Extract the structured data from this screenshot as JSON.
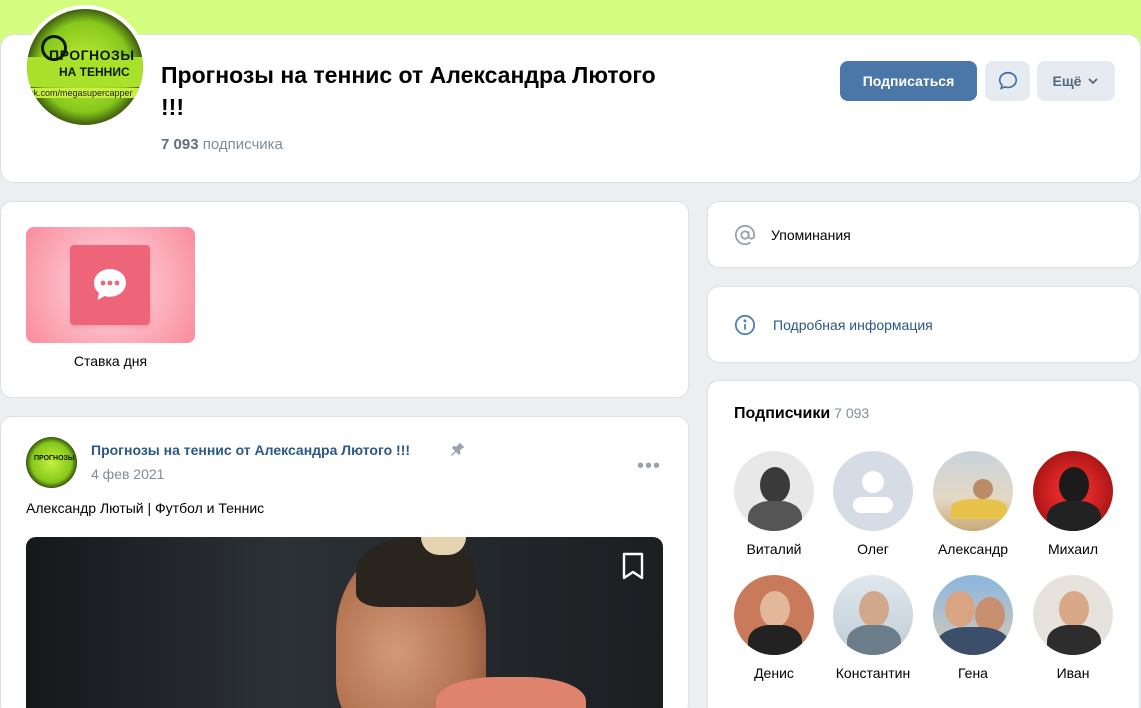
{
  "header": {
    "avatar_text_line1": "ПРОГНОЗЫ",
    "avatar_text_line2": "НА ТЕННИС",
    "avatar_url_text": "vk.com/megasupercapper",
    "title": "Прогнозы на теннис от Александра Лютого !!!",
    "subscribers_number": "7 093",
    "subscribers_word": "подписчика",
    "subscribe_button": "Подписаться",
    "more_button": "Ещё"
  },
  "widget": {
    "label": "Ставка дня"
  },
  "post": {
    "author": "Прогнозы на теннис от Александра Лютого !!!",
    "date": "4 фев 2021",
    "text": "Александр Лютый | Футбол и Теннис",
    "menu": "•••"
  },
  "sidebar": {
    "mentions_label": "Упоминания",
    "info_label": "Подробная информация",
    "followers_title": "Подписчики",
    "followers_count": "7 093",
    "followers": [
      {
        "name": "Виталий"
      },
      {
        "name": "Олег"
      },
      {
        "name": "Александр"
      },
      {
        "name": "Михаил"
      },
      {
        "name": "Денис"
      },
      {
        "name": "Константин"
      },
      {
        "name": "Гена"
      },
      {
        "name": "Иван"
      }
    ]
  },
  "colors": {
    "cover": "#d4fc7e",
    "accent_button": "#4a76a8",
    "link": "#2a5885",
    "widget_pink": "#ee6479"
  },
  "icons": {
    "message": "message-bubble-icon",
    "more_chevron": "chevron-down-icon",
    "pin": "pin-icon",
    "mention": "at-icon",
    "info": "info-circle-icon",
    "bookmark": "bookmark-icon"
  }
}
